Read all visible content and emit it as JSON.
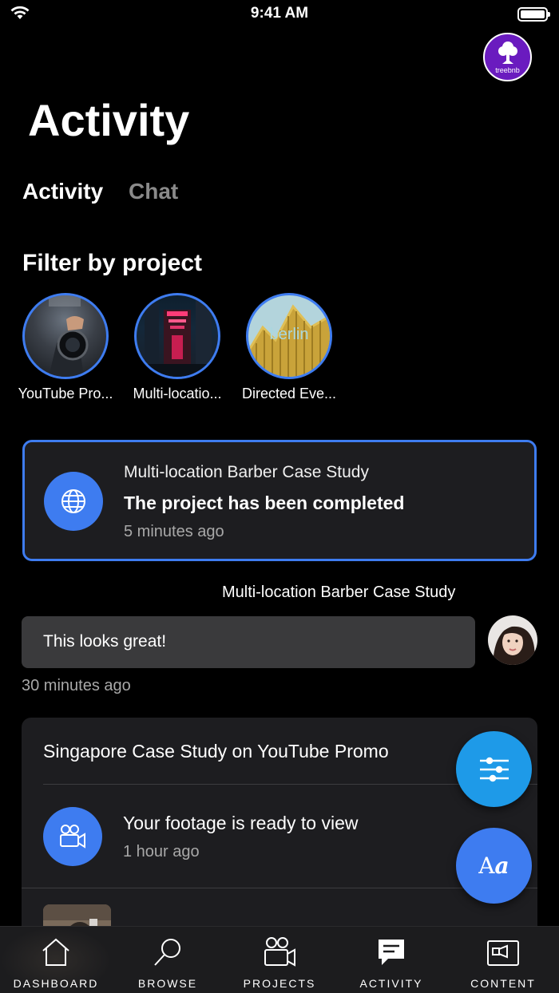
{
  "status_bar": {
    "time": "9:41 AM"
  },
  "brand": {
    "name": "treebnb"
  },
  "page": {
    "title": "Activity"
  },
  "tabs": [
    {
      "label": "Activity",
      "active": true
    },
    {
      "label": "Chat",
      "active": false
    }
  ],
  "filter": {
    "heading": "Filter by project",
    "projects": [
      {
        "label": "YouTube Pro..."
      },
      {
        "label": "Multi-locatio..."
      },
      {
        "label": "Directed Eve...",
        "image_text": "berlin"
      }
    ]
  },
  "highlight_card": {
    "project": "Multi-location Barber Case Study",
    "title": "The project has been completed",
    "time": "5 minutes ago",
    "icon": "globe-icon"
  },
  "chat": {
    "project": "Multi-location Barber Case Study",
    "message": "This looks great!",
    "time": "30 minutes ago"
  },
  "group_card": {
    "title": "Singapore Case Study on YouTube Promo",
    "item_title": "Your footage is ready to view",
    "item_time": "1 hour ago",
    "icon": "camera-icon"
  },
  "fab": {
    "text_label_main": "A",
    "text_label_italic": "a"
  },
  "nav": [
    {
      "label": "DASHBOARD",
      "icon": "home-icon"
    },
    {
      "label": "BROWSE",
      "icon": "search-icon"
    },
    {
      "label": "PROJECTS",
      "icon": "projects-icon"
    },
    {
      "label": "ACTIVITY",
      "icon": "chat-icon",
      "active": true
    },
    {
      "label": "CONTENT",
      "icon": "content-icon"
    }
  ],
  "colors": {
    "accent": "#3e7cf0",
    "fab_filter": "#1e9ae8",
    "brand": "#6a1bbf"
  }
}
